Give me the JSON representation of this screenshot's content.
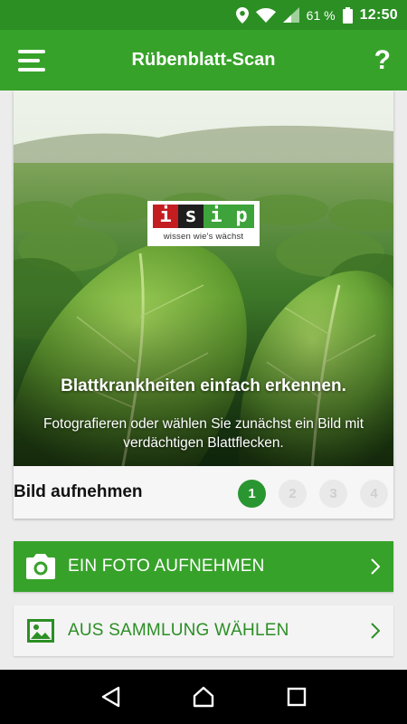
{
  "status_bar": {
    "battery_percent": "61 %",
    "time": "12:50",
    "icons": [
      "location-icon",
      "wifi-icon",
      "signal-icon",
      "battery-icon"
    ]
  },
  "app_bar": {
    "title": "Rübenblatt-Scan",
    "menu_icon": "hamburger-menu-icon",
    "help_label": "?"
  },
  "hero": {
    "logo": {
      "letters": [
        "i",
        "s",
        "i",
        "p"
      ],
      "tagline": "wissen wie's wächst"
    },
    "headline": "Blattkrankheiten einfach erkennen.",
    "subtext": "Fotografieren oder wählen Sie zunächst ein Bild mit verdächtigen Blattflecken."
  },
  "step": {
    "label": "Bild aufnehmen",
    "steps": [
      "1",
      "2",
      "3",
      "4"
    ],
    "active_step": 1
  },
  "actions": {
    "photo": {
      "label": "EIN FOTO AUFNEHMEN",
      "icon": "camera-icon"
    },
    "gallery": {
      "label": "AUS SAMMLUNG WÄHLEN",
      "icon": "image-icon"
    }
  },
  "colors": {
    "primary": "#37a22a",
    "status_bar": "#2b8f24",
    "step_active": "#2a9632"
  }
}
